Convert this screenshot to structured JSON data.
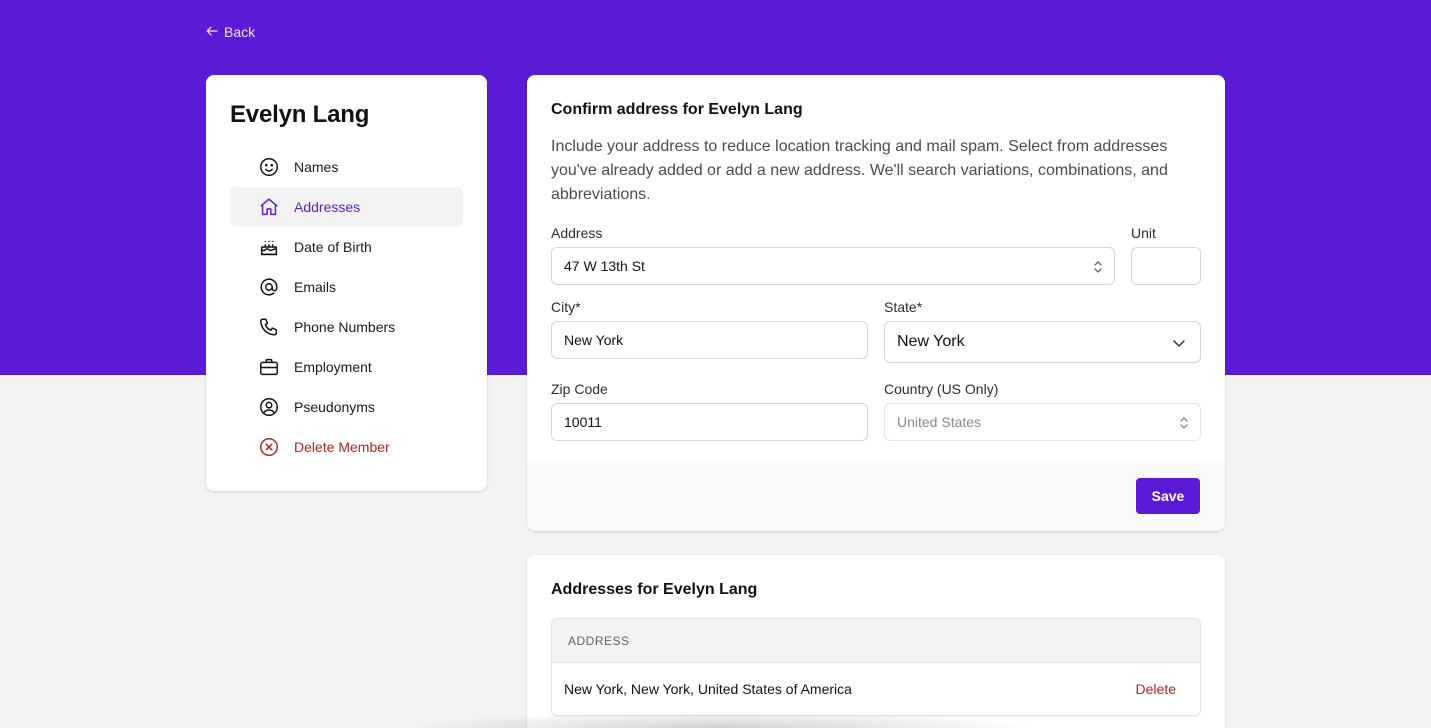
{
  "header": {
    "back_label": "Back"
  },
  "sidebar": {
    "member_name": "Evelyn Lang",
    "items": [
      {
        "label": "Names",
        "icon": "smile-icon"
      },
      {
        "label": "Addresses",
        "icon": "home-icon",
        "active": true
      },
      {
        "label": "Date of Birth",
        "icon": "cake-icon"
      },
      {
        "label": "Emails",
        "icon": "at-sign-icon"
      },
      {
        "label": "Phone Numbers",
        "icon": "phone-icon"
      },
      {
        "label": "Employment",
        "icon": "briefcase-icon"
      },
      {
        "label": "Pseudonyms",
        "icon": "user-circle-icon"
      },
      {
        "label": "Delete Member",
        "icon": "x-circle-icon",
        "danger": true
      }
    ]
  },
  "confirm": {
    "title": "Confirm address for Evelyn Lang",
    "description": "Include your address to reduce location tracking and mail spam. Select from addresses you've already added or add a new address. We'll search variations, combinations, and abbreviations.",
    "address": {
      "label": "Address",
      "value": "47 W 13th St"
    },
    "unit": {
      "label": "Unit",
      "value": ""
    },
    "city": {
      "label": "City*",
      "value": "New York"
    },
    "state": {
      "label": "State*",
      "value": "New York"
    },
    "zip": {
      "label": "Zip Code",
      "value": "10011"
    },
    "country": {
      "label": "Country (US Only)",
      "value": "United States"
    },
    "save_label": "Save"
  },
  "addresses": {
    "title": "Addresses for Evelyn Lang",
    "column_header": "ADDRESS",
    "rows": [
      {
        "address": "New York, New York, United States of America",
        "action": "Delete"
      }
    ]
  },
  "colors": {
    "brand": "#5b1bd6",
    "danger": "#b32222",
    "background": "#f3f3f4"
  }
}
